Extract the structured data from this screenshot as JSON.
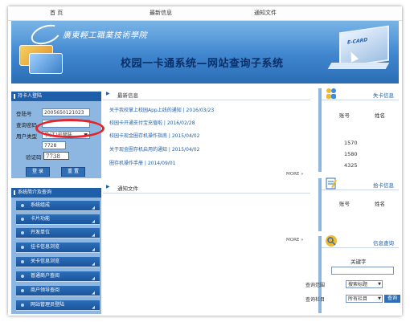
{
  "nav": {
    "home": "首 页",
    "news": "最新信息",
    "notice": "通知文件"
  },
  "banner": {
    "school_name": "廣東輕工職業技術學院",
    "system_title": "校园一卡通系统—网站查询子系统",
    "ecard_label": "E-CARD"
  },
  "login": {
    "header": "持卡人登陆",
    "account_label": "登陆号",
    "account_value": "2005650121023",
    "password_label": "查询密码",
    "usertype_label": "用户类型",
    "usertype_value": "学(工)号登陆",
    "captcha_label": "验证码",
    "captcha_input_value": "7728",
    "captcha_image_text": "7738",
    "login_button": "登 录",
    "reset_button": "重 置"
  },
  "menu": {
    "header": "系统简介及查询",
    "items": [
      "系统组成",
      "卡片功能",
      "开发单位",
      "挂卡信息浏览",
      "关卡信息浏览",
      "普通商户查阅",
      "商户领导查阅",
      "网站管理员登陆"
    ]
  },
  "news": {
    "header": "最新信息",
    "items": [
      "关于我校掌上校园App上线的通知 | 2016/03/23",
      "校园卡开通支付宝充值啦 | 2016/02/28",
      "校园卡现金圈存机操作指南 | 2015/04/02",
      "关于现金圈存机启用的通知 | 2015/04/02",
      "圈存机操作手册 | 2014/09/01"
    ],
    "more": "MORE »"
  },
  "notice": {
    "header": "通知文件",
    "more": "MORE »"
  },
  "lost_card": {
    "header": "失卡信息",
    "col_account": "账号",
    "col_name": "姓名",
    "rows": [
      "1570",
      "1580",
      "4325"
    ]
  },
  "found_card": {
    "header": "拾卡信息",
    "col_account": "账号",
    "col_name": "姓名"
  },
  "info_query": {
    "header": "信息查询",
    "keyword_label": "关键字",
    "scope_label": "查询范围",
    "scope_value": "搜索标题",
    "column_label": "查询栏目",
    "column_value": "所有栏目",
    "submit": "查询"
  },
  "colors": {
    "accent": "#1f5ea8",
    "panel": "#8db6e0",
    "highlight": "#e5242b"
  }
}
